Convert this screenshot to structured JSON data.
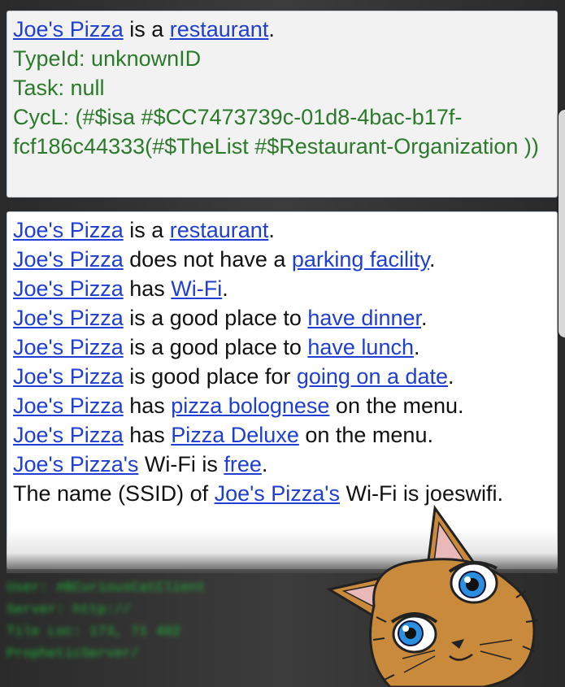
{
  "top_card": {
    "subject": "Joe's Pizza",
    "is_a": " is a ",
    "type_link": "restaurant",
    "period": ".",
    "type_id": "TypeId: unknownID",
    "task": "Task: null",
    "cycl": "CycL: (#$isa #$CC7473739c-01d8-4bac-b17f-fcf186c44333(#$TheList #$Restaurant-Organization ))"
  },
  "facts": [
    {
      "subject": "Joe's Pizza",
      "pre": " is a ",
      "link": "restaurant",
      "post": "."
    },
    {
      "subject": "Joe's Pizza",
      "pre": " does not have a ",
      "link": "parking facility",
      "post": "."
    },
    {
      "subject": "Joe's Pizza",
      "pre": " has ",
      "link": "Wi-Fi",
      "post": "."
    },
    {
      "subject": "Joe's Pizza",
      "pre": " is a good place to ",
      "link": "have dinner",
      "post": "."
    },
    {
      "subject": "Joe's Pizza",
      "pre": " is a good place to ",
      "link": "have lunch",
      "post": "."
    },
    {
      "subject": "Joe's Pizza",
      "pre": " is good place for ",
      "link": "going on a date",
      "post": "."
    },
    {
      "subject": "Joe's Pizza",
      "pre": " has ",
      "link": "pizza bolognese",
      "post": " on the menu."
    },
    {
      "subject": "Joe's Pizza",
      "pre": " has ",
      "link": "Pizza Deluxe",
      "post": " on the menu."
    },
    {
      "subject": "Joe's Pizza's",
      "pre": " Wi-Fi is ",
      "link": "free",
      "post": "."
    }
  ],
  "ssid_fact": {
    "pre": "The name (SSID) of ",
    "subject": "Joe's Pizza's",
    "post": " Wi-Fi is joeswifi."
  },
  "console_lines": [
    "User: #BCuriousCatClient",
    "Server: http://",
    "Tile Loc: 173, 71 402",
    "PropheticServer/"
  ],
  "colors": {
    "link": "#1f3fd2",
    "green_text": "#2b7a2b",
    "console": "#1dcc3a"
  },
  "icons": {
    "mascot": "curious-cat-mascot"
  }
}
